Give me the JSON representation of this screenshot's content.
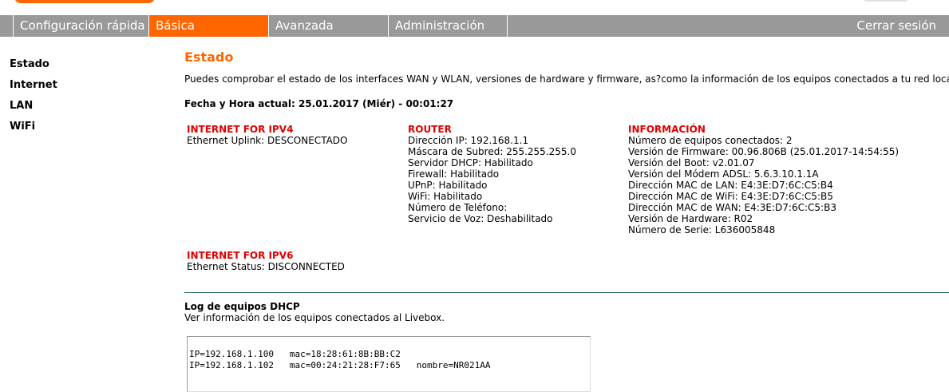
{
  "nav": {
    "tabs": [
      {
        "label": "Configuración rápida"
      },
      {
        "label": "Básica"
      },
      {
        "label": "Avanzada"
      },
      {
        "label": "Administración"
      }
    ],
    "logout_label": "Cerrar sesión",
    "active_tab": "Básica"
  },
  "colors": {
    "accent": "#ff6600",
    "nav_bg": "#999999",
    "section_red": "#e00000",
    "divider": "#1f6b5a"
  },
  "sidebar": {
    "items": [
      {
        "label": "Estado"
      },
      {
        "label": "Internet"
      },
      {
        "label": "LAN"
      },
      {
        "label": "WiFi"
      }
    ]
  },
  "main": {
    "title": "Estado",
    "intro": "Puedes comprobar el estado de los interfaces WAN y WLAN, versiones de hardware y firmware, as?como la información de los equipos conectados a tu red local",
    "datetime": "Fecha y Hora actual: 25.01.2017 (Miér) - 00:01:27",
    "ipv4": {
      "heading": "INTERNET FOR IPV4",
      "rows": [
        "Ethernet Uplink:  DESCONECTADO"
      ]
    },
    "router": {
      "heading": "ROUTER",
      "rows": [
        "Dirección IP:  192.168.1.1",
        "Máscara de Subred:  255.255.255.0",
        "Servidor DHCP:  Habilitado",
        "Firewall:  Habilitado",
        "UPnP:  Habilitado",
        "WiFi:  Habilitado",
        "Número de Teléfono:",
        "Servicio de Voz:  Deshabilitado"
      ]
    },
    "info": {
      "heading": "INFORMACIÓN",
      "rows": [
        "Número de equipos conectados:  2",
        "Versión de Firmware:  00.96.806B (25.01.2017-14:54:55)",
        "Versión del Boot:  v2.01.07",
        "Versión del Módem ADSL: 5.6.3.10.1.1A",
        "Dirección MAC de LAN: E4:3E:D7:6C:C5:B4",
        "Dirección MAC de WiFi: E4:3E:D7:6C:C5:B5",
        "Dirección MAC de WAN: E4:3E:D7:6C:C5:B3",
        "Versión de Hardware:  R02",
        "Número de Serie:   L636005848"
      ]
    },
    "ipv6": {
      "heading": "INTERNET FOR IPV6",
      "rows": [
        "Ethernet Status:  DISCONNECTED"
      ]
    },
    "dhcp_log": {
      "title": "Log de equipos DHCP",
      "subtitle": "Ver información de los equipos conectados al Livebox.",
      "lines": [
        "IP=192.168.1.100   mac=18:28:61:8B:BB:C2",
        "IP=192.168.1.102   mac=00:24:21:28:F7:65   nombre=NR021AA"
      ]
    }
  }
}
